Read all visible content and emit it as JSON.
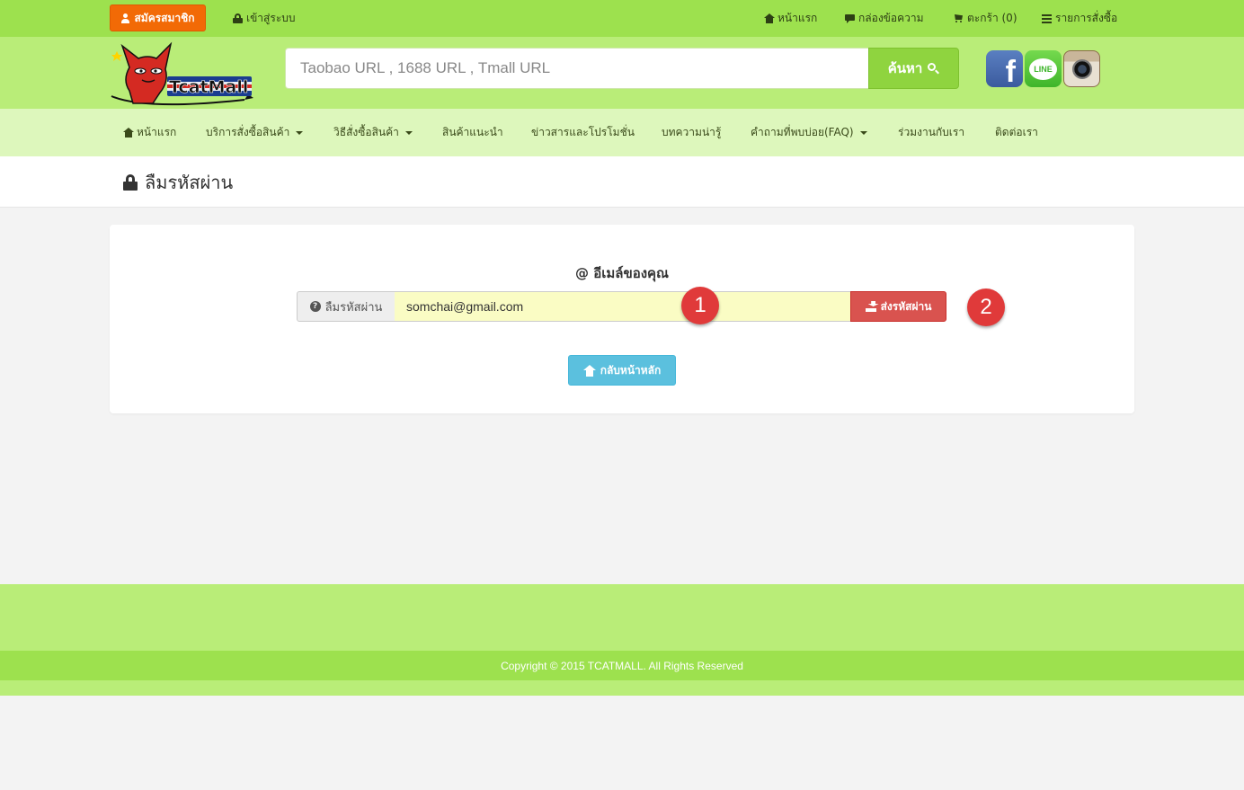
{
  "topbar": {
    "register_label": "สมัครสมาชิก",
    "login_label": "เข้าสู่ระบบ",
    "links": [
      {
        "label": "หน้าแรก",
        "icon": "home-icon"
      },
      {
        "label": "กล่องข้อความ",
        "icon": "comment-icon"
      },
      {
        "label": "ตะกร้า (0)",
        "icon": "cart-icon"
      },
      {
        "label": "รายการสั่งซื้อ",
        "icon": "list-icon"
      }
    ]
  },
  "header": {
    "logo_text": "TcatMall",
    "search_placeholder": "Taobao URL , 1688 URL , Tmall URL",
    "search_button": "ค้นหา",
    "social": [
      "facebook",
      "line",
      "instagram"
    ],
    "line_label": "LINE"
  },
  "nav": {
    "items": [
      {
        "label": "หน้าแรก",
        "dropdown": false
      },
      {
        "label": "บริการสั่งซื้อสินค้า",
        "dropdown": true
      },
      {
        "label": "วิธีสั่งซื้อสินค้า",
        "dropdown": true
      },
      {
        "label": "สินค้าแนะนำ",
        "dropdown": false
      },
      {
        "label": "ข่าวสารและโปรโมชั่น",
        "dropdown": false
      },
      {
        "label": "บทความน่ารู้",
        "dropdown": false
      },
      {
        "label": "คำถามที่พบบ่อย(FAQ)",
        "dropdown": true
      },
      {
        "label": "ร่วมงานกับเรา",
        "dropdown": false
      },
      {
        "label": "ติดต่อเรา",
        "dropdown": false
      }
    ]
  },
  "page": {
    "title": "ลืมรหัสผ่าน"
  },
  "form": {
    "email_label": "@ อีเมล์ของคุณ",
    "addon_label": "ลืมรหัสผ่าน",
    "email_value": "somchai@gmail.com",
    "send_button": "ส่งรหัสผ่าน",
    "back_button": "กลับหน้าหลัก",
    "markers": [
      "1",
      "2"
    ]
  },
  "footer": {
    "copyright": "Copyright © 2015 TCATMALL. All Rights Reserved"
  },
  "colors": {
    "topbar": "#9de14e",
    "header": "#b9ed78",
    "nav": "#ddf7bc",
    "register": "#f26a06",
    "send": "#d9534f",
    "back": "#5bc0de",
    "marker": "#e03a3a"
  }
}
